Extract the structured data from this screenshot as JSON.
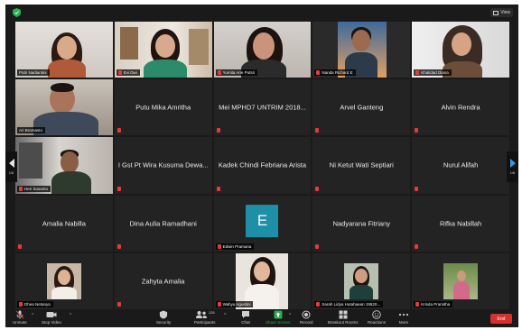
{
  "window": {
    "view_label": "View"
  },
  "pagination": {
    "left_label": "1/6",
    "right_label": "1/6"
  },
  "tiles": [
    {
      "name": "Putri Nadiantini",
      "type": "video"
    },
    {
      "name": "Evi Dwi",
      "type": "video"
    },
    {
      "name": "Yumita Arie Putsri",
      "type": "video"
    },
    {
      "name": "Nanda Richard E",
      "type": "video"
    },
    {
      "name": "Khalidad Diana",
      "type": "video"
    },
    {
      "name": "Ari Bramasto",
      "type": "video"
    },
    {
      "name": "Putu Mika Amritha",
      "type": "name"
    },
    {
      "name": "Mei MPHD7 UNTRIM 2018...",
      "type": "name"
    },
    {
      "name": "Arvel Ganteng",
      "type": "name"
    },
    {
      "name": "Alvin Rendra",
      "type": "name"
    },
    {
      "name": "Heri Susanto",
      "type": "video"
    },
    {
      "name": "I Gst Pt Wira Kusuma Dewa...",
      "type": "name"
    },
    {
      "name": "Kadek Chindi Febriana Arista",
      "type": "name"
    },
    {
      "name": "Ni Ketut Wati Septiari",
      "type": "name"
    },
    {
      "name": "Nurul Alifah",
      "type": "name"
    },
    {
      "name": "Amalia Nabilla",
      "type": "name"
    },
    {
      "name": "Dina Aulia Ramadhani",
      "type": "name"
    },
    {
      "name": "Edwin Pramana",
      "type": "avatar",
      "initial": "E"
    },
    {
      "name": "Nadyarana Fitriany",
      "type": "name"
    },
    {
      "name": "Rifka Nabillah",
      "type": "name"
    },
    {
      "name": "Dhea Netanya",
      "type": "video"
    },
    {
      "name": "Zahyta Amalia",
      "type": "name"
    },
    {
      "name": "Wahyu Agustini",
      "type": "video"
    },
    {
      "name": "Sarah Lidya Hutahaean 19520...",
      "type": "video"
    },
    {
      "name": "Krisda Pramitha",
      "type": "video"
    }
  ],
  "toolbar": {
    "unmute": "Unmute",
    "stop_video": "Stop Video",
    "security": "Security",
    "participants": "Participants",
    "participants_count": "128",
    "chat": "Chat",
    "share_screen": "Share Screen",
    "record": "Record",
    "breakout": "Breakout Rooms",
    "reactions": "Reactions",
    "more": "More",
    "end": "End"
  },
  "colors": {
    "window_bg": "#1a1a1a",
    "tile_bg": "#232323",
    "mute_red": "#e23b3b",
    "share_green": "#23b14d",
    "end_red": "#d8312d",
    "avatar_teal": "#1d8fa6",
    "arrow_blue": "#2d9cf0"
  }
}
